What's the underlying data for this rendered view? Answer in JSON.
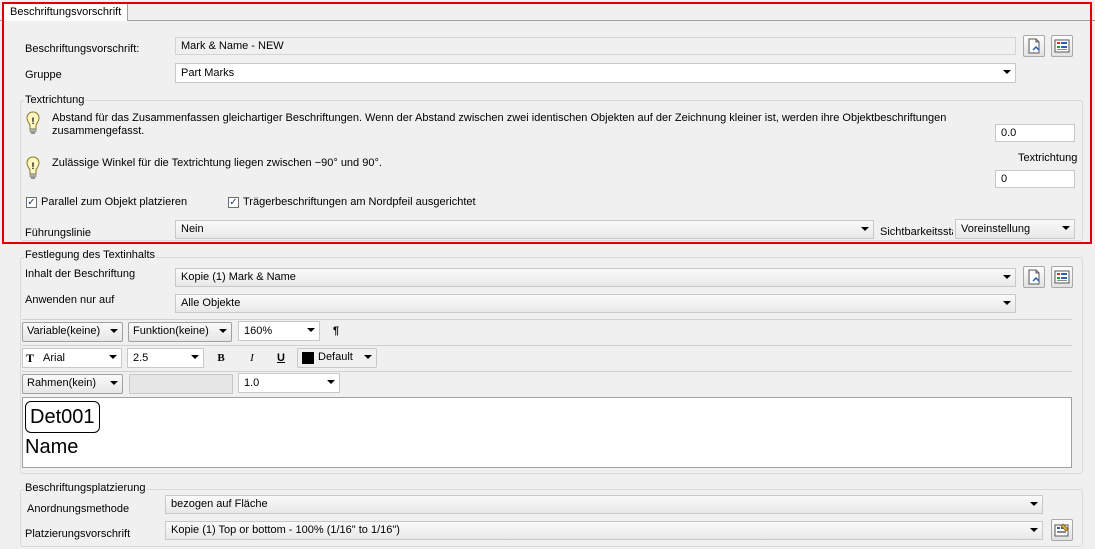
{
  "tab": {
    "label": "Beschriftungsvorschrift"
  },
  "rule": {
    "label": "Beschriftungsvorschrift:",
    "value": "Mark & Name - NEW"
  },
  "group_field": {
    "label": "Gruppe",
    "value": "Part Marks"
  },
  "textrichtung": {
    "title": "Textrichtung",
    "info1": "Abstand für das Zusammenfassen gleichartiger Beschriftungen. Wenn der Abstand  zwischen zwei identischen Objekten auf der Zeichnung kleiner ist, werden ihre Objektbeschriftungen zusammengefasst.",
    "distance_value": "0.0",
    "info2": "Zulässige Winkel für die Textrichtung liegen zwischen −90° und 90°.",
    "angle_label": "Textrichtung",
    "angle_value": "0",
    "chk_parallel": "Parallel zum Objekt platzieren",
    "chk_north": "Trägerbeschriftungen am Nordpfeil ausgerichtet"
  },
  "leader": {
    "label": "Führungslinie",
    "value": "Nein"
  },
  "visibility": {
    "label": "Sichtbarkeitssta",
    "value": "Voreinstellung"
  },
  "content": {
    "title": "Festlegung des Textinhalts",
    "inhalt_label": "Inhalt der Beschriftung",
    "inhalt_value": "Kopie (1) Mark & Name",
    "apply_label": "Anwenden nur auf",
    "apply_value": "Alle Objekte"
  },
  "toolbar": {
    "variable": "Variable(keine)",
    "function": "Funktion(keine)",
    "zoom": "160%",
    "pilcrow": "¶",
    "font": "Arial",
    "size": "2.5",
    "bold": "B",
    "italic": "I",
    "underline": "U",
    "color": "Default",
    "frame": "Rahmen(kein)",
    "linewidth": "1.0"
  },
  "editor": {
    "line1": "Det001",
    "line2": "Name"
  },
  "placement": {
    "title": "Beschriftungsplatzierung",
    "method_label": "Anordnungsmethode",
    "method_value": "bezogen auf Fläche",
    "rule_label": "Platzierungsvorschrift",
    "rule_value": "Kopie (1) Top or bottom - 100% (1/16\" to 1/16\")"
  },
  "colors": {
    "highlight": "#e00000",
    "panel": "#f0f0f0"
  }
}
